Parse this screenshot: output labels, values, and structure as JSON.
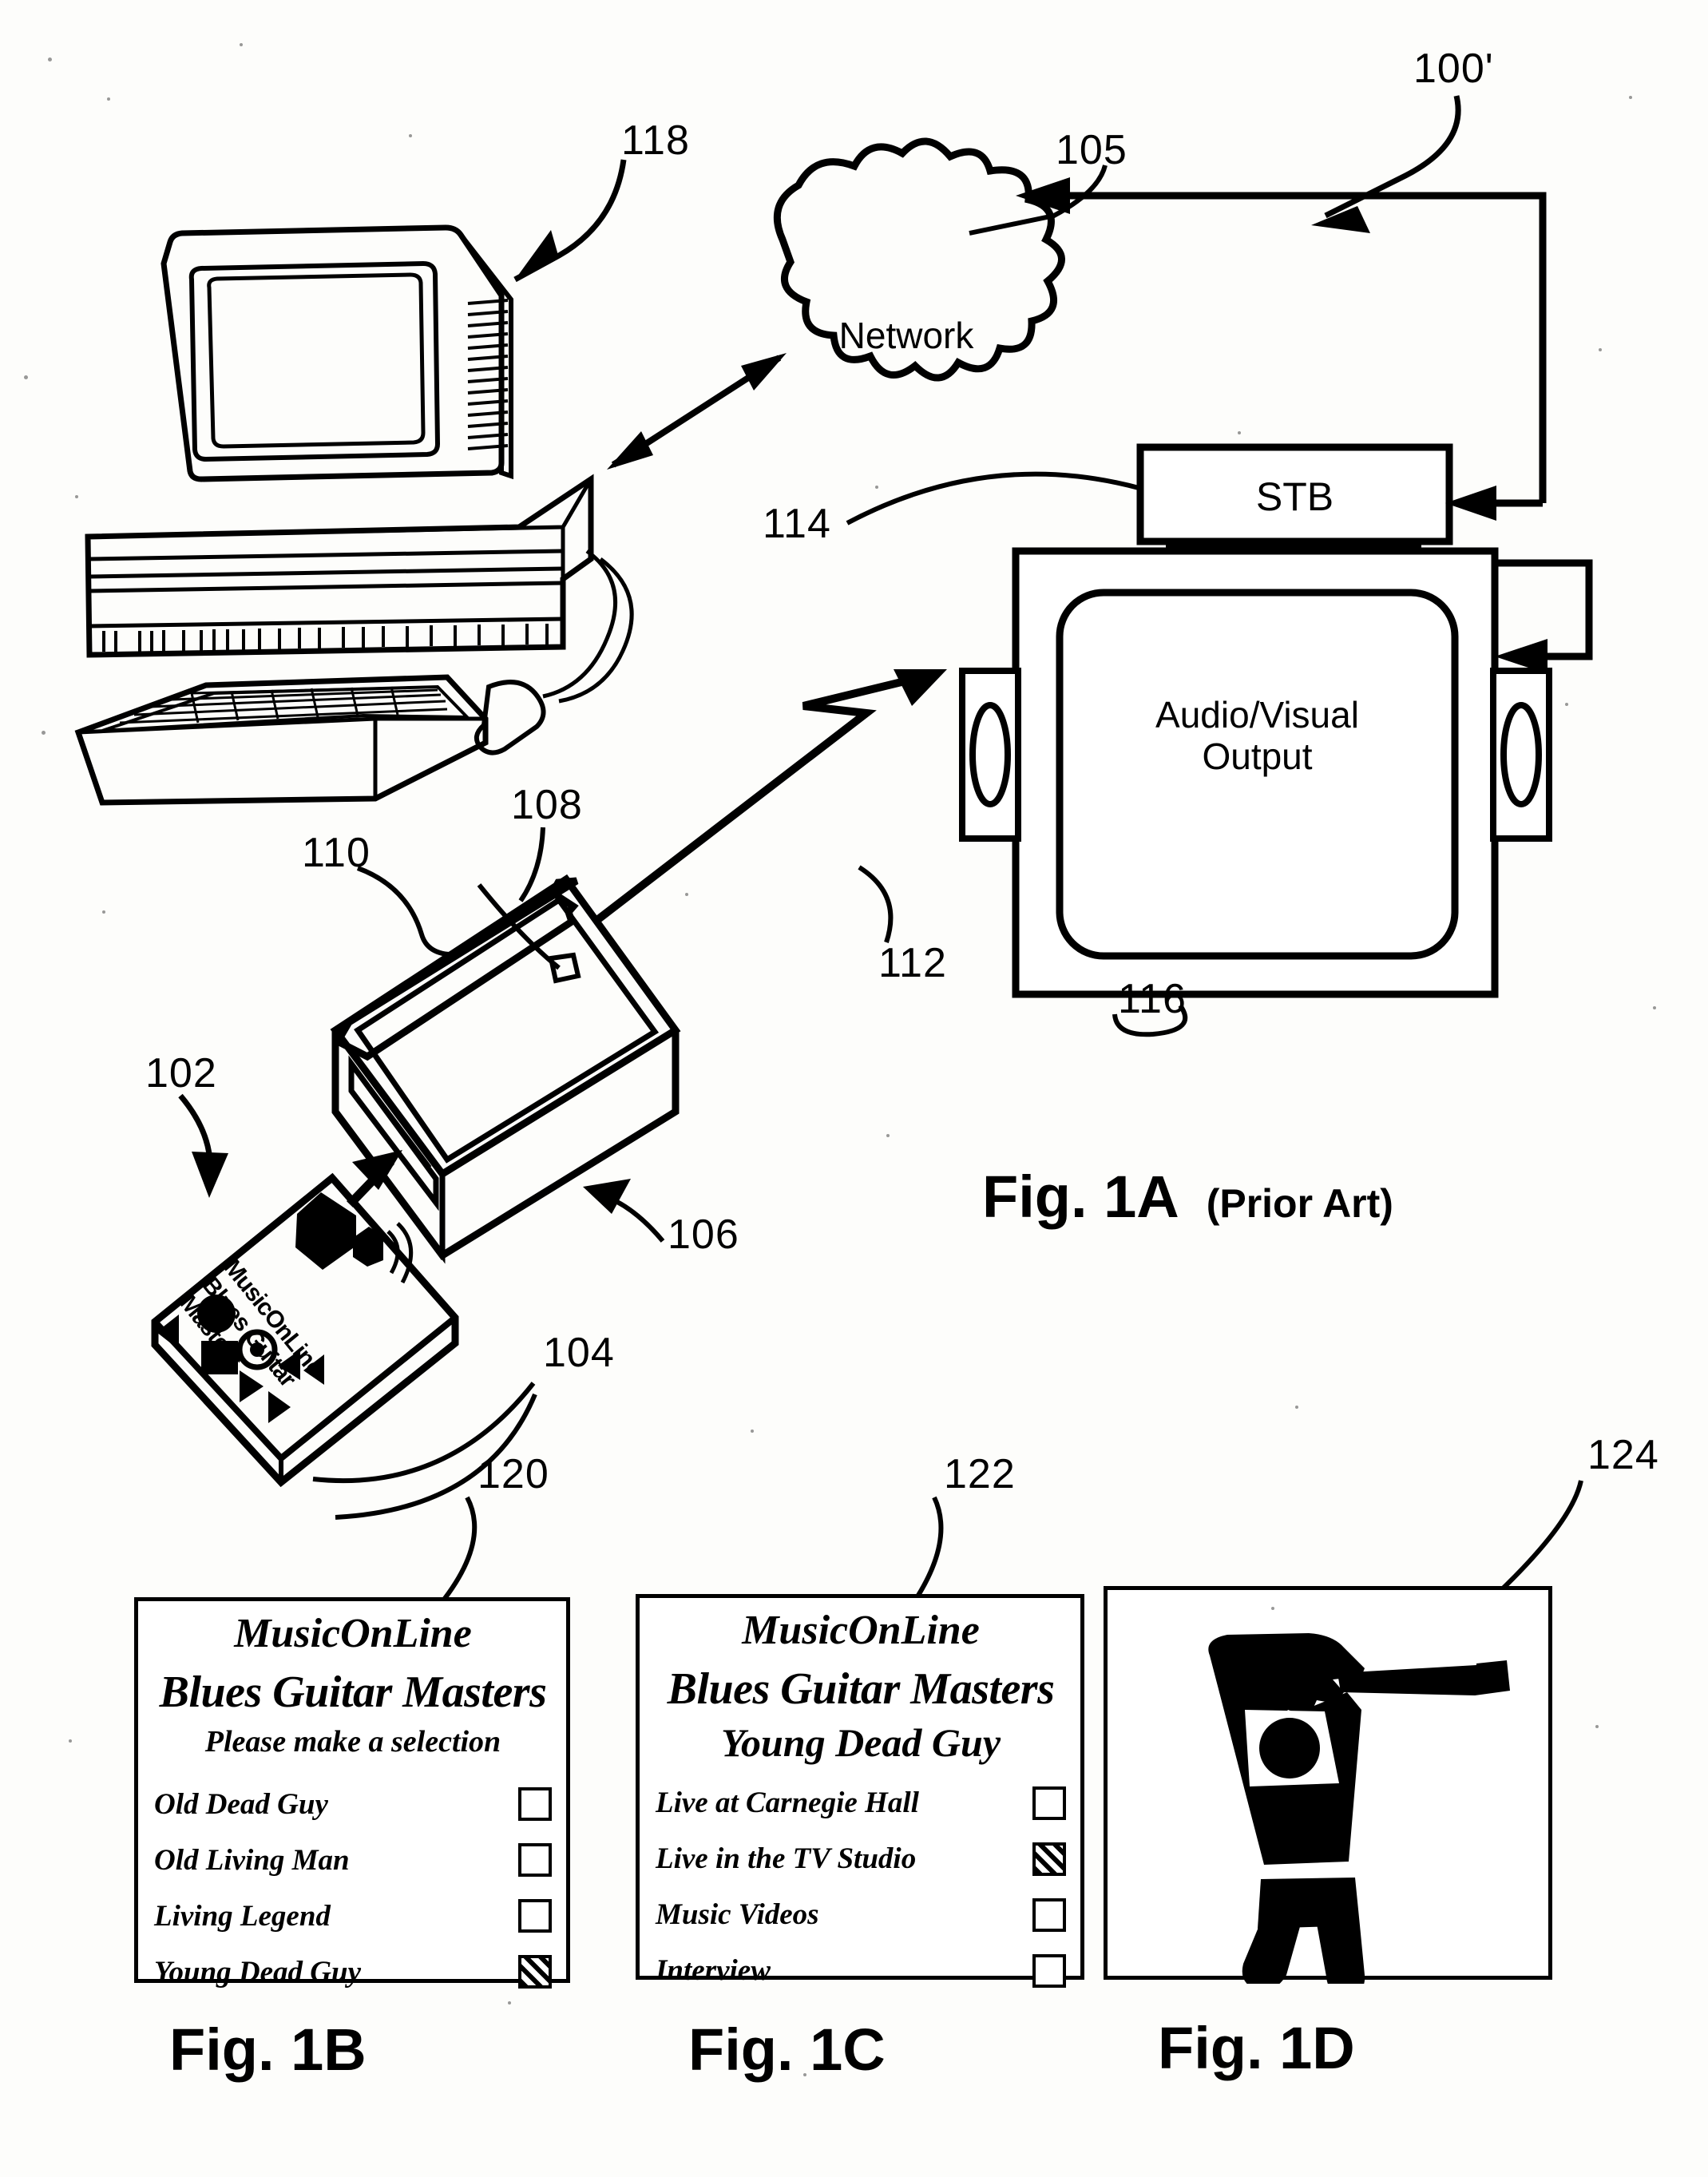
{
  "figure": {
    "sheet_type": "patent-drawing",
    "fig1a": {
      "caption": "Fig. 1A",
      "caption_note": "(Prior Art)",
      "nodes": {
        "network": "Network",
        "stb": "STB",
        "av_output_line1": "Audio/Visual",
        "av_output_line2": "Output"
      },
      "reference_numerals": [
        {
          "id": "100",
          "text": "100'",
          "points_to": "overall-system"
        },
        {
          "id": "105",
          "text": "105",
          "points_to": "network-cloud"
        },
        {
          "id": "118",
          "text": "118",
          "points_to": "personal-computer"
        },
        {
          "id": "114",
          "text": "114",
          "points_to": "set-top-box"
        },
        {
          "id": "116",
          "text": "116",
          "points_to": "audio-visual-output"
        },
        {
          "id": "112",
          "text": "112",
          "points_to": "wireless-link"
        },
        {
          "id": "108",
          "text": "108",
          "points_to": "reader-top-surface"
        },
        {
          "id": "110",
          "text": "110",
          "points_to": "reader-antenna"
        },
        {
          "id": "106",
          "text": "106",
          "points_to": "card-reader"
        },
        {
          "id": "104",
          "text": "104",
          "points_to": "card-face"
        },
        {
          "id": "102",
          "text": "102",
          "points_to": "media-card"
        }
      ],
      "card": {
        "brand": "MusicOnLine",
        "line2": "Blues Guitar",
        "line3": "Masters",
        "icons": [
          "speaker-icon",
          "play-icon",
          "stop-icon",
          "record-icon",
          "rewind-icon",
          "forward-icon"
        ]
      }
    },
    "fig1b": {
      "caption": "Fig. 1B",
      "numeral": "120",
      "screen": {
        "brand": "MusicOnLine",
        "album": "Blues Guitar Masters",
        "subtitle": "Please make a selection",
        "options": [
          {
            "label": "Old Dead Guy",
            "checked": false
          },
          {
            "label": "Old Living Man",
            "checked": false
          },
          {
            "label": "Living Legend",
            "checked": false
          },
          {
            "label": "Young Dead Guy",
            "checked": true
          }
        ]
      }
    },
    "fig1c": {
      "caption": "Fig. 1C",
      "numeral": "122",
      "screen": {
        "brand": "MusicOnLine",
        "album": "Blues Guitar Masters",
        "artist": "Young Dead Guy",
        "options": [
          {
            "label": "Live at Carnegie Hall",
            "checked": false
          },
          {
            "label": "Live in the TV Studio",
            "checked": true
          },
          {
            "label": "Music Videos",
            "checked": false
          },
          {
            "label": "Interview",
            "checked": false
          }
        ]
      }
    },
    "fig1d": {
      "caption": "Fig. 1D",
      "numeral": "124",
      "screen": {
        "content": "guitarist-silhouette-icon"
      }
    },
    "colors": {
      "ink": "#000000",
      "paper": "#fdfdfb"
    }
  }
}
